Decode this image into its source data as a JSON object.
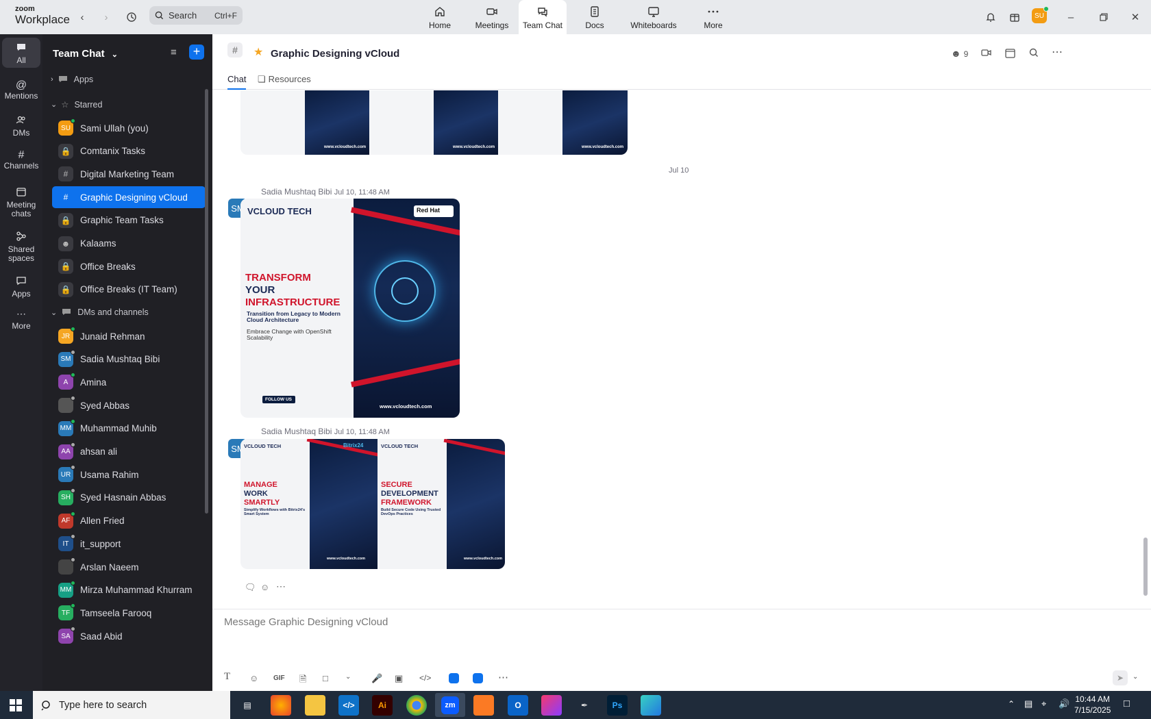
{
  "app": {
    "brand_top": "zoom",
    "brand_bottom": "Workplace"
  },
  "search": {
    "placeholder": "Search",
    "shortcut": "Ctrl+F"
  },
  "nav_tabs": [
    {
      "label": "Home",
      "icon": "home-icon"
    },
    {
      "label": "Meetings",
      "icon": "video-camera-icon"
    },
    {
      "label": "Team Chat",
      "icon": "chat-bubbles-icon",
      "active": true
    },
    {
      "label": "Docs",
      "icon": "document-icon"
    },
    {
      "label": "Whiteboards",
      "icon": "whiteboard-icon"
    },
    {
      "label": "More",
      "icon": "more-dots-icon"
    }
  ],
  "user": {
    "initials": "SU"
  },
  "rail": [
    {
      "label": "All",
      "active": true
    },
    {
      "label": "Mentions"
    },
    {
      "label": "DMs"
    },
    {
      "label": "Channels"
    },
    {
      "label": "Meeting chats"
    },
    {
      "label": "Shared spaces"
    },
    {
      "label": "Apps"
    },
    {
      "label": "More"
    }
  ],
  "sidebar": {
    "header": "Team Chat",
    "apps_label": "Apps",
    "starred_label": "Starred",
    "starred": [
      {
        "name": "Sami Ullah (you)",
        "initials": "SU",
        "color": "#f39c12",
        "status": "online"
      },
      {
        "name": "Comtanix Tasks",
        "icon": "lock"
      },
      {
        "name": "Digital Marketing Team",
        "icon": "hash"
      },
      {
        "name": "Graphic Designing vCloud",
        "icon": "hash",
        "active": true
      },
      {
        "name": "Graphic Team Tasks",
        "icon": "lock"
      },
      {
        "name": "Kalaams",
        "icon": "group"
      },
      {
        "name": "Office Breaks",
        "icon": "lock"
      },
      {
        "name": "Office Breaks (IT Team)",
        "icon": "lock"
      }
    ],
    "dms_label": "DMs and channels",
    "dms": [
      {
        "name": "Junaid Rehman",
        "initials": "JR",
        "color": "#f5a623",
        "status": "online"
      },
      {
        "name": "Sadia Mushtaq Bibi",
        "initials": "SM",
        "color": "#2a7ab8",
        "status": "away"
      },
      {
        "name": "Amina",
        "initials": "A",
        "color": "#8e44ad",
        "status": "online"
      },
      {
        "name": "Syed Abbas",
        "initials": "",
        "color": "#555555",
        "status": "away"
      },
      {
        "name": "Muhammad Muhib",
        "initials": "MM",
        "color": "#2a7ab8",
        "status": "online"
      },
      {
        "name": "ahsan ali",
        "initials": "AA",
        "color": "#8e44ad",
        "status": "away"
      },
      {
        "name": "Usama Rahim",
        "initials": "UR",
        "color": "#2a7ab8",
        "status": "away"
      },
      {
        "name": "Syed Hasnain Abbas",
        "initials": "SH",
        "color": "#27ae60",
        "status": "away"
      },
      {
        "name": "Allen Fried",
        "initials": "AF",
        "color": "#c0392b",
        "status": "online"
      },
      {
        "name": "it_support",
        "initials": "IT",
        "color": "#1f4f8a",
        "status": "away"
      },
      {
        "name": "Arslan Naeem",
        "initials": "",
        "color": "#444444",
        "status": "away"
      },
      {
        "name": "Mirza Muhammad Khurram",
        "initials": "MM",
        "color": "#16a085",
        "status": "online"
      },
      {
        "name": "Tamseela Farooq",
        "initials": "TF",
        "color": "#27ae60",
        "status": "online"
      },
      {
        "name": "Saad Abid",
        "initials": "SA",
        "color": "#8e44ad",
        "status": "away"
      }
    ]
  },
  "channel": {
    "title": "Graphic Designing vCloud",
    "member_count": "9",
    "tabs": [
      "Chat",
      "Resources"
    ]
  },
  "messages": {
    "date_divider": "Jul 10",
    "msg1": {
      "author": "Sadia Mushtaq Bibi",
      "time": "Jul 10, 11:48 AM",
      "initials": "SM"
    },
    "msg2": {
      "author": "Sadia Mushtaq Bibi",
      "time": "Jul 10, 11:48 AM",
      "initials": "SM"
    },
    "poster_big": {
      "brand": "VCLOUD TECH",
      "partner": "Red Hat",
      "headline1": "TRANSFORM",
      "headline2": "YOUR",
      "headline3": "INFRASTRUCTURE",
      "sub": "Transition from Legacy to Modern Cloud Architecture",
      "sub2": "Embrace Change with OpenShift Scalability",
      "follow": "FOLLOW US",
      "website": "www.vcloudtech.com"
    },
    "poster_a": {
      "brand": "VCLOUD TECH",
      "partner": "Bitrix24",
      "h1": "MANAGE",
      "h2": "WORK",
      "h3": "SMARTLY",
      "sub": "Simplify Workflows with Bitrix24's Smart System",
      "website": "www.vcloudtech.com"
    },
    "poster_b": {
      "brand": "VCLOUD TECH",
      "h1": "SECURE",
      "h2": "DEVELOPMENT",
      "h3": "FRAMEWORK",
      "sub": "Build Secure Code Using Trusted DevOps Practices",
      "website": "www.vcloudtech.com"
    },
    "top_posters": [
      "www.vcloudtech.com",
      "www.vcloudtech.com",
      "www.vcloudtech.com"
    ]
  },
  "composer": {
    "placeholder": "Message Graphic Designing vCloud",
    "gif_label": "GIF"
  },
  "taskbar": {
    "search_placeholder": "Type here to search",
    "time": "10:44 AM",
    "date": "7/15/2025",
    "apps": [
      "Task View",
      "Firefox",
      "File Explorer",
      "VS Code",
      "Illustrator",
      "Chrome",
      "Zoom",
      "XAMPP",
      "Outlook",
      "Creative Cloud",
      "Pen Tool",
      "Photoshop",
      "App"
    ]
  },
  "colors": {
    "accent": "#0e72ed",
    "rail": "#232329",
    "sidebar": "#202025",
    "brand_red": "#d0142b"
  }
}
